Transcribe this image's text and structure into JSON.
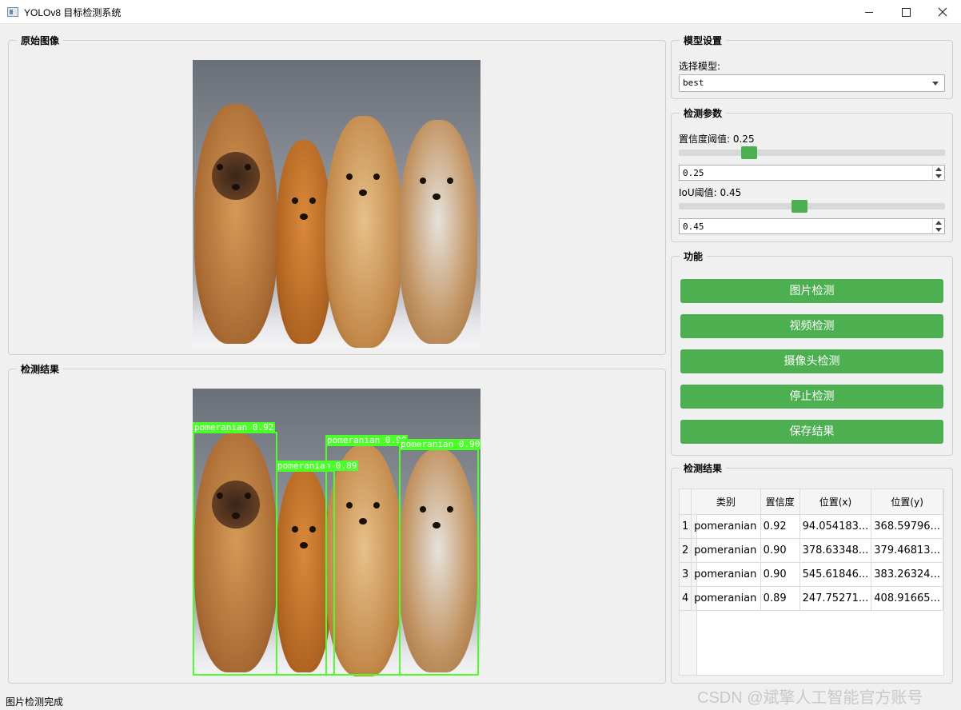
{
  "window": {
    "title": "YOLOv8 目标检测系统"
  },
  "original_image": {
    "title": "原始图像"
  },
  "result_image": {
    "title": "检测结果",
    "detections": [
      {
        "label": "pomeranian 0.92"
      },
      {
        "label": "pomeranian 0.89"
      },
      {
        "label": "pomeranian 0.90"
      },
      {
        "label": "pomeranian 0.90"
      }
    ]
  },
  "model_settings": {
    "title": "模型设置",
    "select_label": "选择模型:",
    "selected_model": "best"
  },
  "detect_params": {
    "title": "检测参数",
    "conf_label": "置信度阈值: 0.25",
    "conf_value": "0.25",
    "conf_slider_fraction": 0.25,
    "iou_label": "IoU阈值: 0.45",
    "iou_value": "0.45",
    "iou_slider_fraction": 0.45
  },
  "functions": {
    "title": "功能",
    "image_detect": "图片检测",
    "video_detect": "视频检测",
    "camera_detect": "摄像头检测",
    "stop_detect": "停止检测",
    "save_result": "保存结果"
  },
  "results_table": {
    "title": "检测结果",
    "headers": [
      "类别",
      "置信度",
      "位置(x)",
      "位置(y)"
    ],
    "rows": [
      {
        "num": "1",
        "class": "pomeranian",
        "conf": "0.92",
        "x": "94.054183...",
        "y": "368.59796..."
      },
      {
        "num": "2",
        "class": "pomeranian",
        "conf": "0.90",
        "x": "378.63348...",
        "y": "379.46813..."
      },
      {
        "num": "3",
        "class": "pomeranian",
        "conf": "0.90",
        "x": "545.61846...",
        "y": "383.26324..."
      },
      {
        "num": "4",
        "class": "pomeranian",
        "conf": "0.89",
        "x": "247.75271...",
        "y": "408.91665..."
      }
    ]
  },
  "status_bar": {
    "text": "图片检测完成"
  },
  "watermark": "CSDN @斌擎人工智能官方账号",
  "colors": {
    "accent": "#4caf50",
    "detection_box": "#4cff2a"
  }
}
